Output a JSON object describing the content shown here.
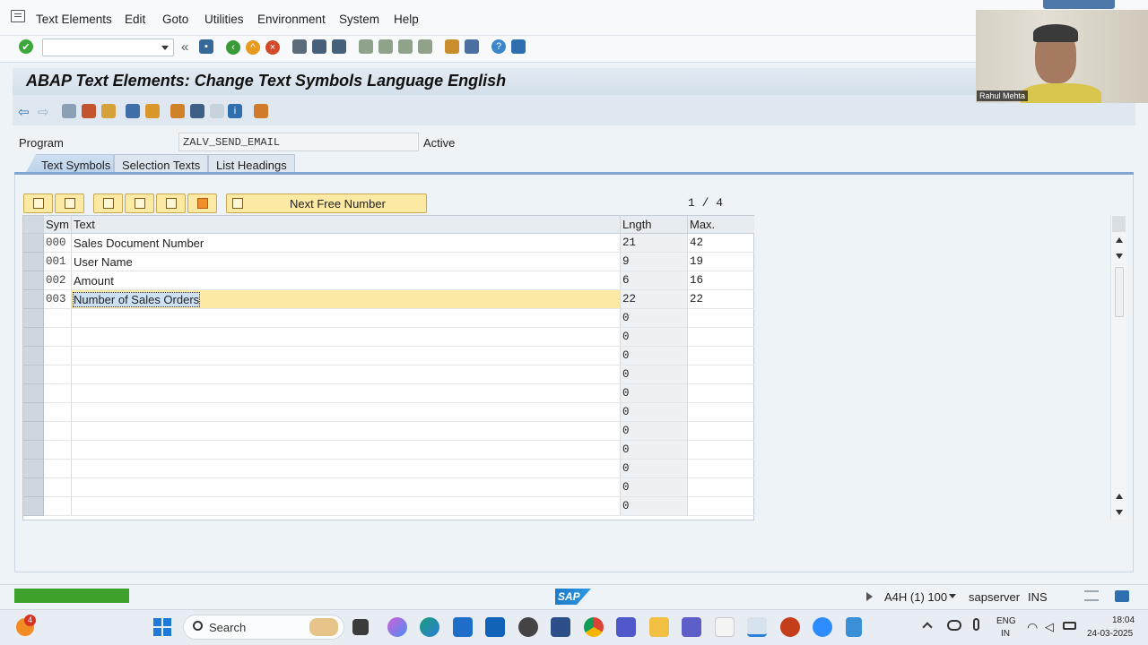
{
  "menu": [
    "Text Elements",
    "Edit",
    "Goto",
    "Utilities",
    "Environment",
    "System",
    "Help"
  ],
  "title": "ABAP Text Elements: Change Text Symbols Language English",
  "program": {
    "label": "Program",
    "value": "ZALV_SEND_EMAIL",
    "status": "Active"
  },
  "tabs": [
    "Text Symbols",
    "Selection Texts",
    "List Headings"
  ],
  "table_toolbar": {
    "next_free_label": "Next Free Number",
    "pager": "1 / 4"
  },
  "table": {
    "headers": [
      "Sym",
      "Text",
      "Lngth",
      "Max."
    ],
    "rows": [
      {
        "sym": "000",
        "text": "Sales Document Number",
        "lngth": "21",
        "max": "42"
      },
      {
        "sym": "001",
        "text": "User Name",
        "lngth": "9",
        "max": "19"
      },
      {
        "sym": "002",
        "text": "Amount",
        "lngth": "6",
        "max": "16"
      },
      {
        "sym": "003",
        "text": "Number of Sales Orders",
        "lngth": "22",
        "max": "22"
      },
      {
        "sym": "",
        "text": "",
        "lngth": "0",
        "max": ""
      },
      {
        "sym": "",
        "text": "",
        "lngth": "0",
        "max": ""
      },
      {
        "sym": "",
        "text": "",
        "lngth": "0",
        "max": ""
      },
      {
        "sym": "",
        "text": "",
        "lngth": "0",
        "max": ""
      },
      {
        "sym": "",
        "text": "",
        "lngth": "0",
        "max": ""
      },
      {
        "sym": "",
        "text": "",
        "lngth": "0",
        "max": ""
      },
      {
        "sym": "",
        "text": "",
        "lngth": "0",
        "max": ""
      },
      {
        "sym": "",
        "text": "",
        "lngth": "0",
        "max": ""
      },
      {
        "sym": "",
        "text": "",
        "lngth": "0",
        "max": ""
      },
      {
        "sym": "",
        "text": "",
        "lngth": "0",
        "max": ""
      },
      {
        "sym": "",
        "text": "",
        "lngth": "0",
        "max": ""
      }
    ]
  },
  "statusbar": {
    "system": "A4H (1) 100",
    "server": "sapserver",
    "mode": "INS",
    "logo": "SAP"
  },
  "taskbar": {
    "search_placeholder": "Search",
    "lang_top": "ENG",
    "lang_bottom": "IN",
    "time": "18:04",
    "date": "24-03-2025",
    "notification_count": "4"
  },
  "webcam": {
    "name": "Rahul Mehta"
  },
  "colors": {
    "highlight_row": "#fbe9a4",
    "progress": "#3da32c",
    "tab_active": "#b9d1ea"
  }
}
